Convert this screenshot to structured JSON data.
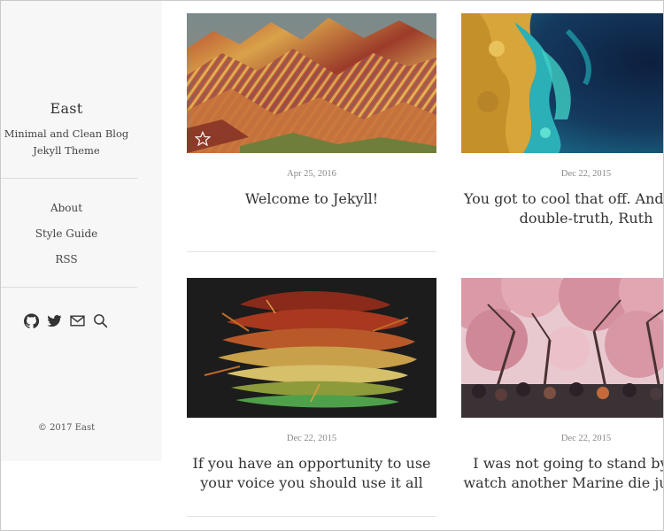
{
  "site": {
    "title": "East",
    "description_line1": "Minimal and Clean Blog",
    "description_line2": "Jekyll Theme",
    "copyright": "© 2017 East"
  },
  "nav": {
    "items": [
      {
        "label": "About"
      },
      {
        "label": "Style Guide"
      },
      {
        "label": "RSS"
      }
    ]
  },
  "social": {
    "icons": [
      "github-icon",
      "twitter-icon",
      "mail-icon",
      "search-icon"
    ]
  },
  "posts": [
    {
      "date": "Apr 25, 2016",
      "title": "Welcome to Jekyll!",
      "image": "rainbow-mountains",
      "featured": true
    },
    {
      "date": "Dec 22, 2015",
      "title": "You got to cool that off. And that's double-truth, Ruth",
      "image": "aerial-coastline",
      "featured": false
    },
    {
      "date": "Dec 22, 2015",
      "title": "If you have an opportunity to use your voice you should use it all",
      "image": "layered-leaves",
      "featured": false
    },
    {
      "date": "Dec 22, 2015",
      "title": "I was not going to stand by and watch another Marine die just to l",
      "image": "cherry-blossom-street",
      "featured": false
    }
  ],
  "colors": {
    "sidebar_bg": "#f7f7f7",
    "text": "#333333",
    "date": "#888888",
    "divider": "#dcdcdc"
  }
}
